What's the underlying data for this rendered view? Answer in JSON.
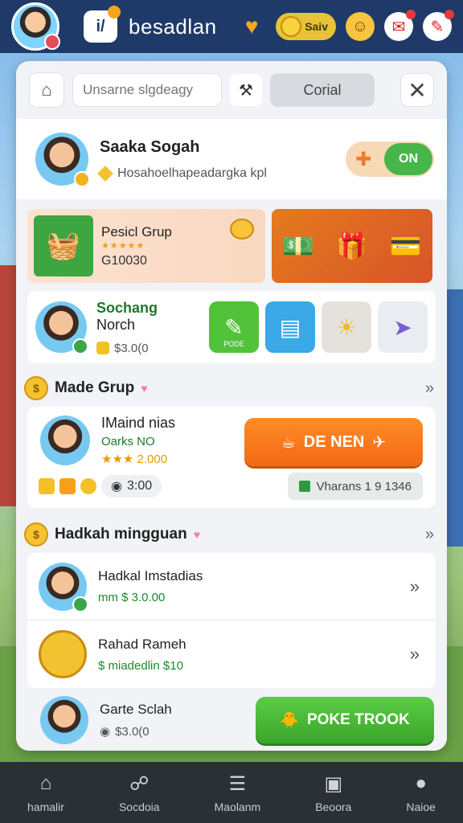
{
  "topbar": {
    "logo_text": "i/",
    "app_title": "besadlan",
    "coin_label": "Saiv"
  },
  "search": {
    "placeholder": "Unsarne slgdeagy",
    "corial_label": "Corial"
  },
  "profile": {
    "name": "Saaka Sogah",
    "subtitle": "Hosahoelhapeadargka kpl",
    "toggle_label": "ON"
  },
  "promo": {
    "title": "Pesicl Grup",
    "stars": "★★★★★",
    "value": "G10030"
  },
  "friend": {
    "name_green": "Sochang",
    "name_rest": " Norch",
    "value": "$3.0(0",
    "action_label": "PODE"
  },
  "made_group": {
    "title": "Made Grup",
    "member_name": "IMaind nias",
    "member_sub": "Oarks NO",
    "member_stars": "★★★ 2.000",
    "join_label": "DE NEN",
    "time_label": "3:00",
    "viewers_label": "Vharans 1 9 1346"
  },
  "weekly": {
    "title": "Hadkah mingguan",
    "items": [
      {
        "name": "Hadkal Imstadias",
        "value": "mm $ 3.0.00"
      },
      {
        "name": "Rahad Rameh",
        "value": "$ miadedlin $10"
      }
    ],
    "bottom_name": "Garte Sclah",
    "bottom_value": "$3.0(0",
    "poke_label": "POKE TROOK"
  },
  "nav": [
    {
      "label": "hamalir",
      "icon": "home-icon"
    },
    {
      "label": "Socdoia",
      "icon": "social-icon"
    },
    {
      "label": "Maolanm",
      "icon": "list-icon"
    },
    {
      "label": "Beoora",
      "icon": "bag-icon"
    },
    {
      "label": "Naioe",
      "icon": "profile-icon"
    }
  ],
  "colors": {
    "topbar": "#1f3a68",
    "join_button": "#f16a13",
    "poke_button": "#3aa52b",
    "nav_bar": "#2b2f36"
  }
}
